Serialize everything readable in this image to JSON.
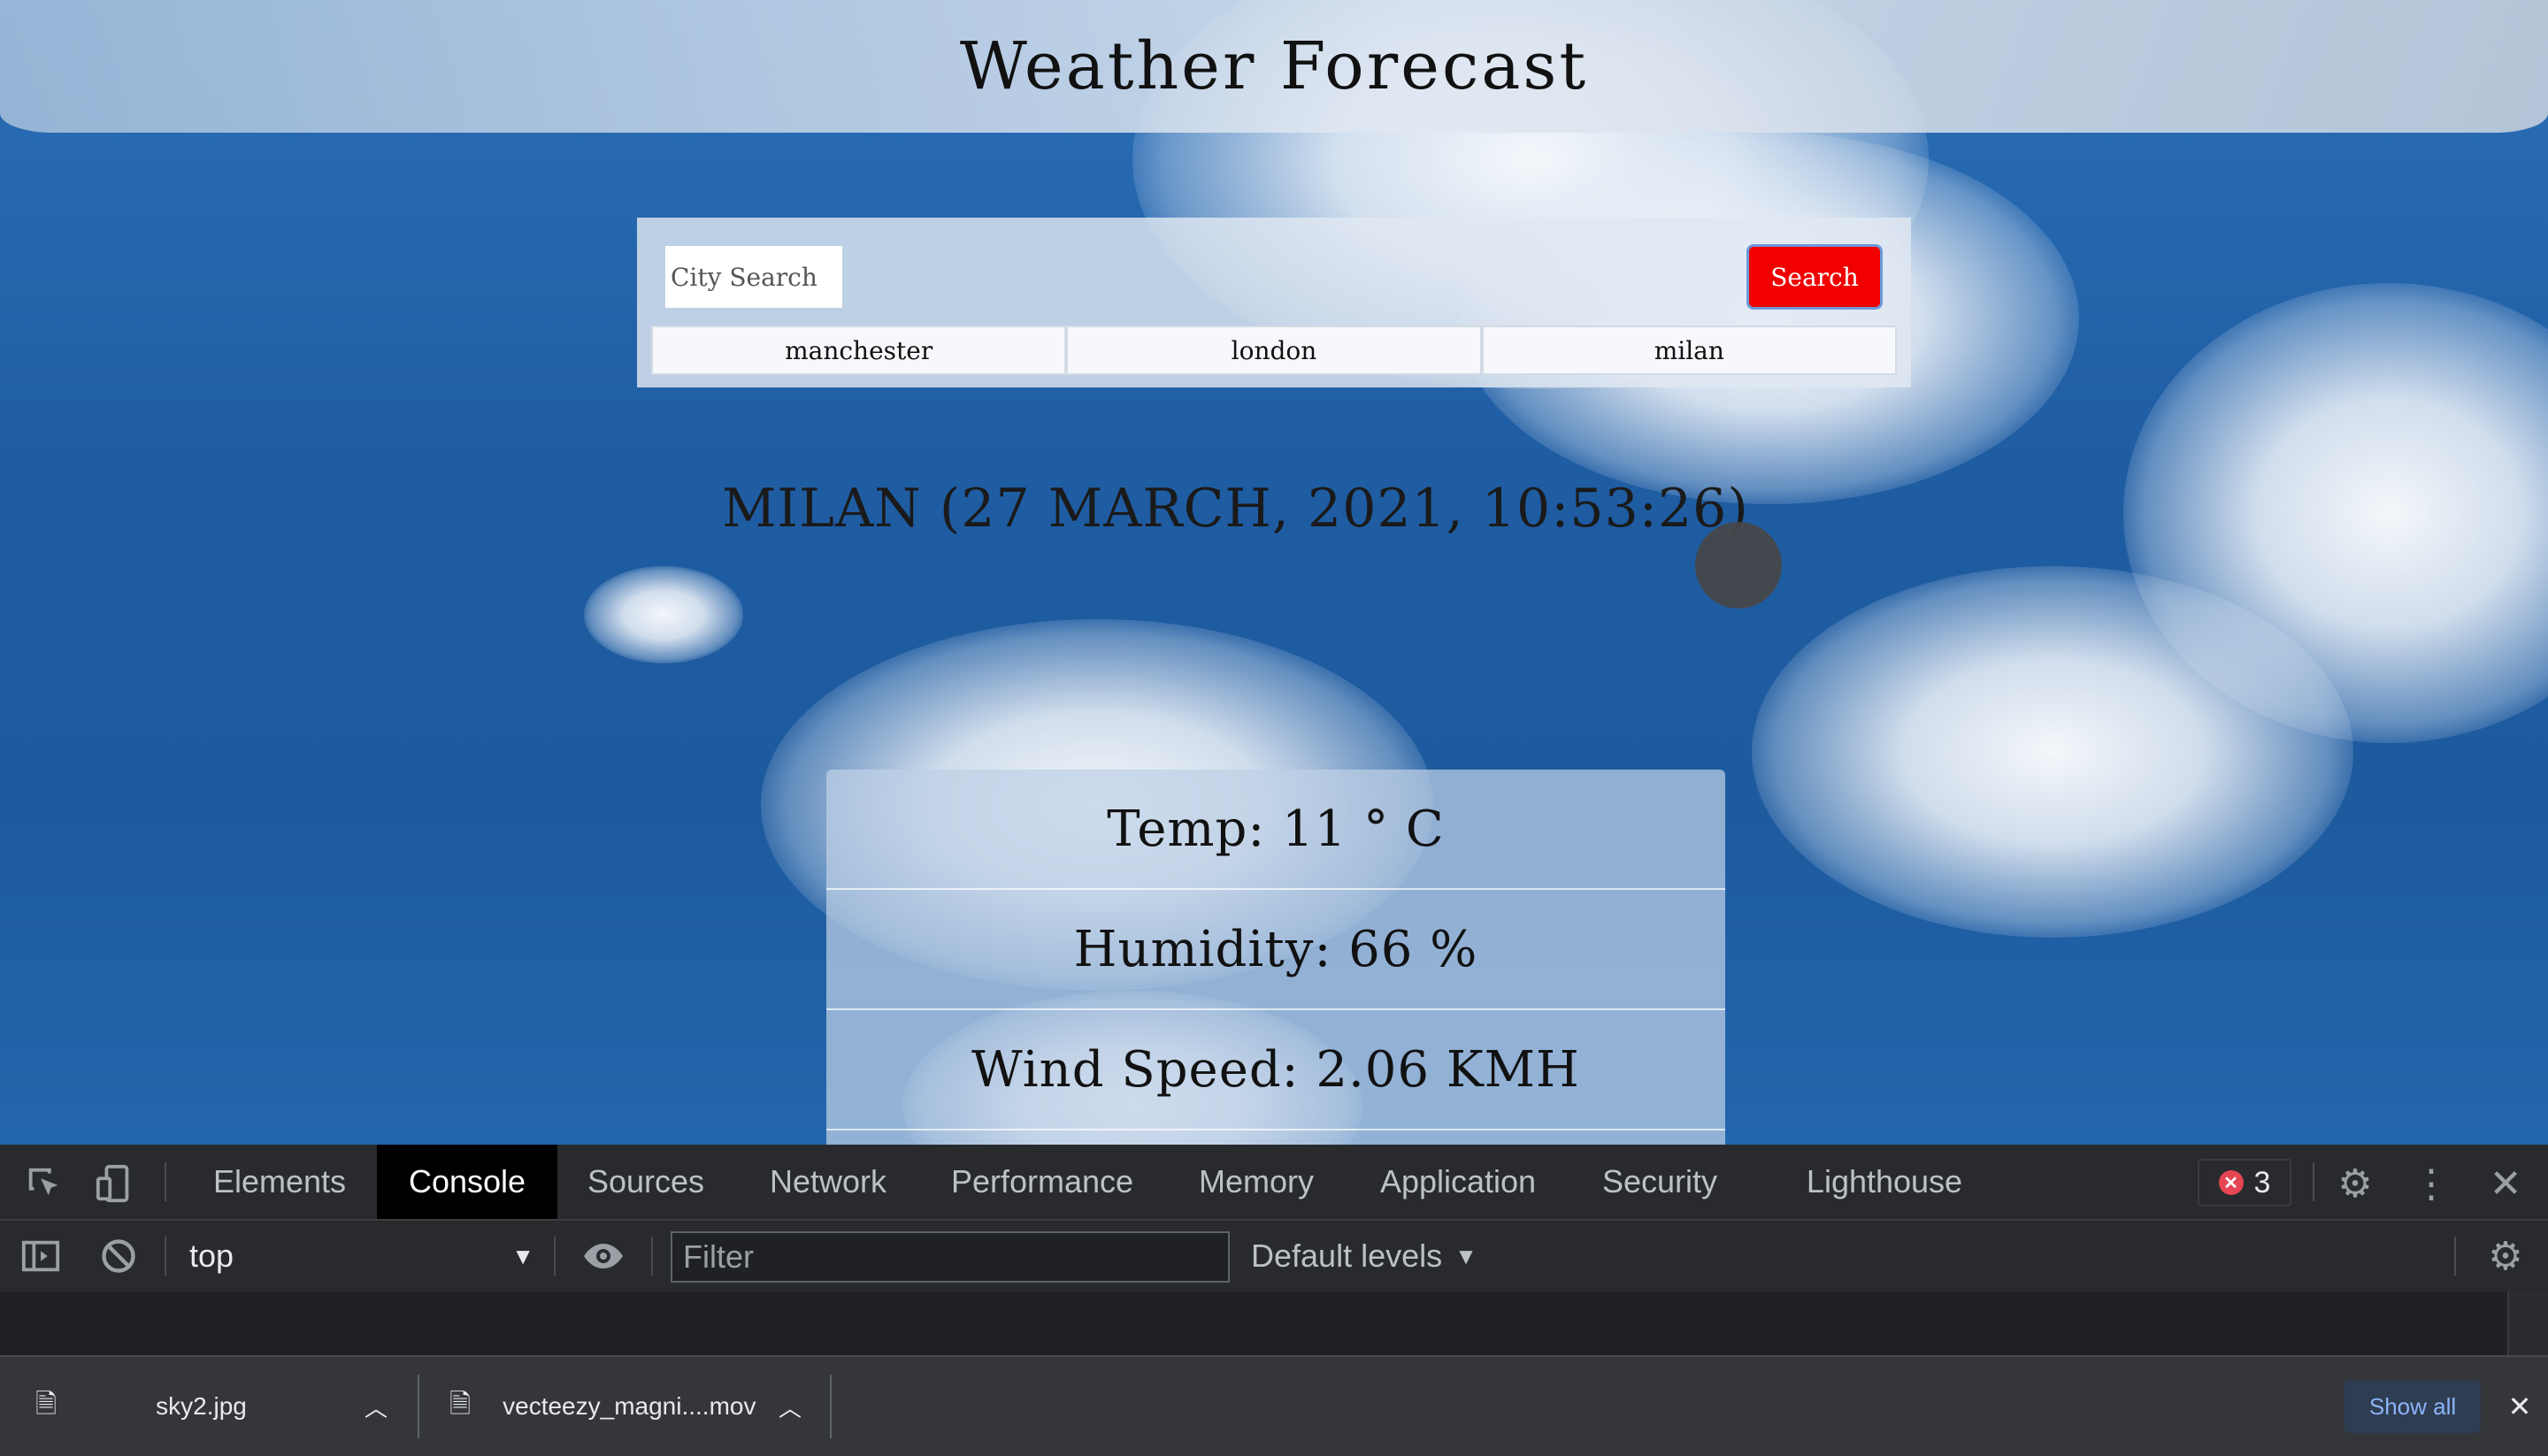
{
  "page": {
    "title": "Weather Forecast",
    "search": {
      "placeholder": "City Search",
      "button_label": "Search",
      "history": [
        "manchester",
        "london",
        "milan"
      ]
    },
    "city_heading": "MILAN (27 MARCH,  2021,  10:53:26)",
    "stats": {
      "temp": "Temp: 11 ° C",
      "humidity": "Humidity: 66 %",
      "wind": "Wind Speed: 2.06 KMH"
    },
    "colors": {
      "search_button": "#f20000",
      "sky": "#1f5da3"
    }
  },
  "devtools": {
    "tabs": [
      "Elements",
      "Console",
      "Sources",
      "Network",
      "Performance",
      "Memory",
      "Application",
      "Security",
      "Lighthouse"
    ],
    "active_tab": "Console",
    "error_count": "3",
    "context": "top",
    "filter_placeholder": "Filter",
    "levels_label": "Default levels"
  },
  "downloads": {
    "items": [
      {
        "name": "sky2.jpg",
        "icon": "file-icon"
      },
      {
        "name": "vecteezy_magni....mov",
        "icon": "video-file-icon"
      }
    ],
    "show_all_label": "Show all"
  }
}
